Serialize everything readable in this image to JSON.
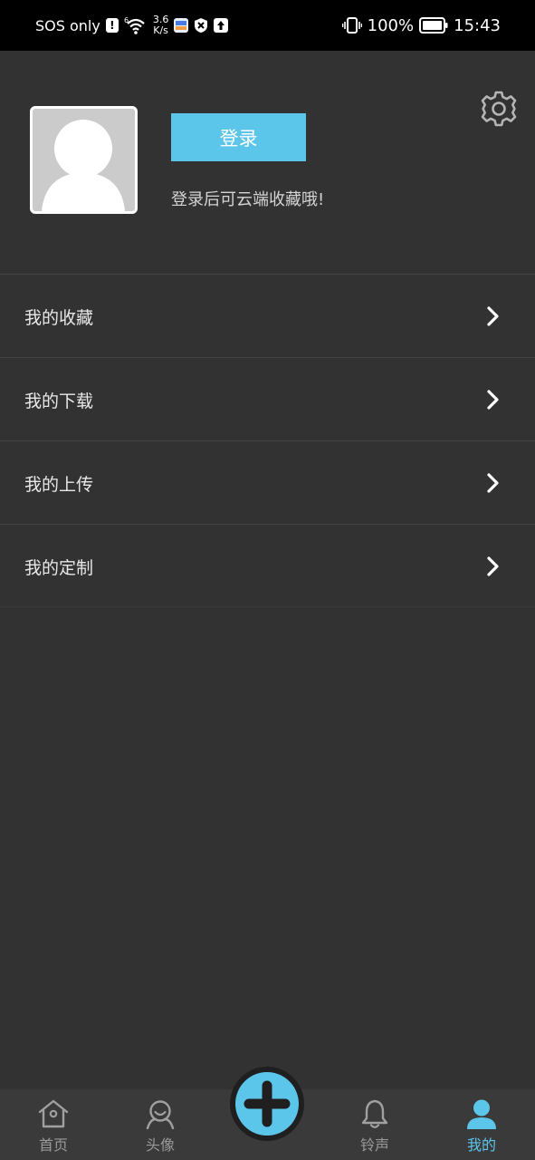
{
  "status_bar": {
    "carrier": "SOS only",
    "sos_badge": "!",
    "wifi_gen": "6",
    "net_speed_value": "3.6",
    "net_speed_unit": "K/s",
    "battery_percent": "100%",
    "time": "15:43"
  },
  "profile": {
    "login_label": "登录",
    "login_hint": "登录后可云端收藏哦!"
  },
  "menu": {
    "items": [
      {
        "label": "我的收藏"
      },
      {
        "label": "我的下载"
      },
      {
        "label": "我的上传"
      },
      {
        "label": "我的定制"
      }
    ]
  },
  "bottom_nav": {
    "items": [
      {
        "label": "首页",
        "icon": "home-icon"
      },
      {
        "label": "头像",
        "icon": "avatar-face-icon"
      },
      {
        "label": "铃声",
        "icon": "bell-icon"
      },
      {
        "label": "我的",
        "icon": "person-icon",
        "active": true
      }
    ],
    "fab_icon": "plus-icon"
  },
  "colors": {
    "accent": "#5cc5ea",
    "background": "#323232",
    "status_bar": "#000000",
    "nav_background": "#3a3a3a"
  }
}
